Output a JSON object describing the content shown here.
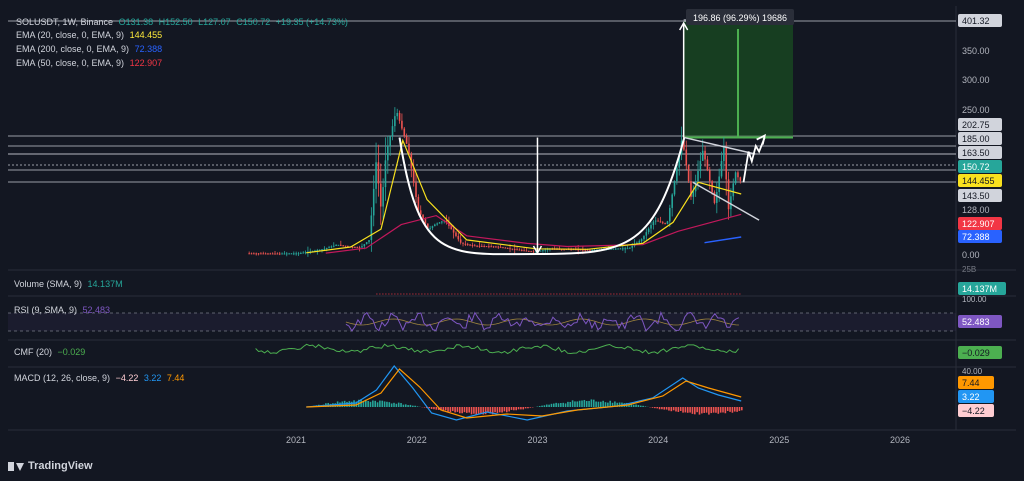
{
  "legend": {
    "main": {
      "symbol": "SOLUSDT, 1W, Binance",
      "ohlc_o": "O131.38",
      "ohlc_h": "H152.50",
      "ohlc_l": "L127.07",
      "ohlc_c": "C150.72",
      "change": "+19.35 (+14.73%)"
    },
    "ema20": {
      "label": "EMA (20, close, 0, EMA, 9)",
      "value": "144.455",
      "color": "#ffeb3b"
    },
    "ema200": {
      "label": "EMA (200, close, 0, EMA, 9)",
      "value": "72.388",
      "color": "#2962ff"
    },
    "ema50": {
      "label": "EMA (50, close, 0, EMA, 9)",
      "value": "122.907",
      "color": "#f23645"
    }
  },
  "indicators": {
    "volume": {
      "label": "Volume (SMA, 9)",
      "value": "14.137M"
    },
    "rsi": {
      "label": "RSI (9, SMA, 9)",
      "value": "52.483"
    },
    "cmf": {
      "label": "CMF (20)",
      "value": "−0.029"
    },
    "macd": {
      "label": "MACD (12, 26, close, 9)",
      "v1": "−4.22",
      "v2": "3.22",
      "v3": "7.44"
    }
  },
  "measure_label": "196.86 (96.29%) 19686",
  "branding": "TradingView",
  "chart_data": {
    "type": "candlestick",
    "symbol": "SOLUSDT",
    "interval": "1W",
    "exchange": "Binance",
    "x_ticks": [
      "2021",
      "2022",
      "2023",
      "2024",
      "2025",
      "2026"
    ],
    "y_ticks": [
      "350.00",
      "300.00",
      "250.00",
      "128.00",
      "0.00"
    ],
    "price_levels": [
      "401.32",
      "202.75",
      "185.00",
      "163.50",
      "150.72",
      "144.455",
      "143.50",
      "122.907",
      "72.388"
    ],
    "level_colors": {
      "401.32": "#d1d4dc",
      "202.75": "#d1d4dc",
      "185.00": "#d1d4dc",
      "163.50": "#d1d4dc",
      "150.72": "#26a69a",
      "144.455": "#ffeb3b",
      "143.50": "#d1d4dc",
      "122.907": "#f23645",
      "72.388": "#2962ff"
    },
    "ylim": [
      -10,
      405
    ],
    "path": [
      [
        "2020-08-10",
        3
      ],
      [
        "2020-11-15",
        2
      ],
      [
        "2021-01-15",
        3
      ],
      [
        "2021-02-20",
        12
      ],
      [
        "2021-04-01",
        22
      ],
      [
        "2021-05-10",
        40
      ],
      [
        "2021-06-20",
        30
      ],
      [
        "2021-07-20",
        28
      ],
      [
        "2021-08-15",
        60
      ],
      [
        "2021-09-05",
        160
      ],
      [
        "2021-09-20",
        130
      ],
      [
        "2021-10-05",
        165
      ],
      [
        "2021-11-05",
        250
      ],
      [
        "2021-11-25",
        210
      ],
      [
        "2021-12-10",
        180
      ],
      [
        "2022-01-10",
        130
      ],
      [
        "2022-02-10",
        90
      ],
      [
        "2022-03-01",
        100
      ],
      [
        "2022-04-01",
        110
      ],
      [
        "2022-05-20",
        45
      ],
      [
        "2022-07-01",
        35
      ],
      [
        "2022-09-01",
        32
      ],
      [
        "2022-11-08",
        18
      ],
      [
        "2022-12-28",
        9
      ],
      [
        "2023-02-10",
        22
      ],
      [
        "2023-04-15",
        21
      ],
      [
        "2023-06-15",
        17
      ],
      [
        "2023-08-15",
        22
      ],
      [
        "2023-10-10",
        25
      ],
      [
        "2023-11-15",
        60
      ],
      [
        "2023-12-25",
        110
      ],
      [
        "2024-02-01",
        100
      ],
      [
        "2024-03-18",
        200
      ],
      [
        "2024-04-15",
        140
      ],
      [
        "2024-05-20",
        175
      ],
      [
        "2024-06-25",
        135
      ],
      [
        "2024-07-22",
        185
      ],
      [
        "2024-08-05",
        130
      ],
      [
        "2024-08-26",
        155
      ],
      [
        "2024-09-08",
        150.72
      ]
    ],
    "ema20": [
      [
        "2021-02-01",
        5
      ],
      [
        "2021-06-15",
        30
      ],
      [
        "2021-09-15",
        90
      ],
      [
        "2021-11-20",
        195
      ],
      [
        "2022-02-01",
        140
      ],
      [
        "2022-06-01",
        60
      ],
      [
        "2022-12-28",
        22
      ],
      [
        "2023-06-01",
        20
      ],
      [
        "2023-11-15",
        45
      ],
      [
        "2024-02-15",
        105
      ],
      [
        "2024-05-01",
        150
      ],
      [
        "2024-09-08",
        144.455
      ]
    ],
    "ema50": [
      [
        "2021-04-01",
        4
      ],
      [
        "2021-08-01",
        25
      ],
      [
        "2021-11-15",
        100
      ],
      [
        "2022-03-01",
        120
      ],
      [
        "2022-06-01",
        75
      ],
      [
        "2022-12-01",
        45
      ],
      [
        "2023-04-01",
        32
      ],
      [
        "2023-11-15",
        40
      ],
      [
        "2024-03-01",
        85
      ],
      [
        "2024-09-08",
        122.907
      ]
    ],
    "ema200": [
      [
        "2024-05-20",
        48
      ],
      [
        "2024-09-08",
        72.388
      ]
    ],
    "measure": {
      "x": "2024-03-18",
      "from": 200,
      "to": 401.32,
      "label": "196.86 (96.29%) 19686"
    },
    "cup": {
      "from": [
        "2021-11-10",
        200
      ],
      "bottom": [
        "2023-01-01",
        0
      ],
      "to": [
        "2024-03-20",
        200
      ]
    },
    "flag_upper": [
      [
        "2024-03-20",
        200
      ],
      [
        "2024-10-20",
        163.5
      ]
    ],
    "flag_lower": [
      [
        "2024-04-15",
        150
      ],
      [
        "2024-11-01",
        110
      ]
    ],
    "cup_depth_arrow": {
      "x": "2023-01-01",
      "from": 200,
      "to": 0
    },
    "projection": [
      [
        "2024-09-15",
        150
      ],
      [
        "2024-09-30",
        170
      ],
      [
        "2024-10-10",
        160
      ],
      [
        "2024-10-22",
        185
      ],
      [
        "2024-11-01",
        170
      ],
      [
        "2024-11-18",
        200
      ]
    ],
    "rsi_value": 52.483,
    "cmf_value": -0.029,
    "macd": {
      "macd": 3.22,
      "signal": 7.44,
      "hist": -4.22
    },
    "volume_sma": "14.137M"
  }
}
